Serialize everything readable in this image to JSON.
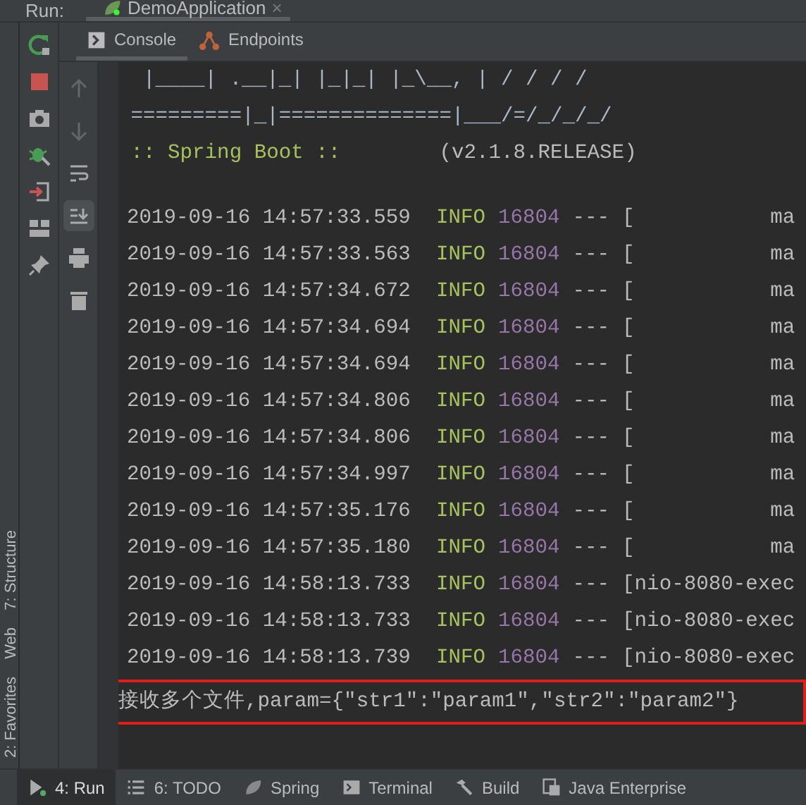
{
  "run_bar": {
    "label": "Run:",
    "tab": {
      "title": "DemoApplication",
      "close": "×"
    }
  },
  "console_tabs": [
    {
      "label": "Console",
      "kind": "console",
      "selected": true
    },
    {
      "label": "Endpoints",
      "kind": "endpoints",
      "selected": false
    }
  ],
  "banner": [
    {
      "text": "  |____| .__|_| |_|_| |_\\__, | / / / /",
      "kind": "art"
    },
    {
      "text": " =========|_|==============|___/=/_/_/_/",
      "kind": "art"
    },
    {
      "text": " :: Spring Boot ::        (v2.1.8.RELEASE)",
      "kind": "version"
    }
  ],
  "log": [
    {
      "timestamp": "2019-09-16 14:57:33.559",
      "level": "INFO",
      "pid": "16804",
      "separator": "---",
      "thread": "[           ma"
    },
    {
      "timestamp": "2019-09-16 14:57:33.563",
      "level": "INFO",
      "pid": "16804",
      "separator": "---",
      "thread": "[           ma"
    },
    {
      "timestamp": "2019-09-16 14:57:34.672",
      "level": "INFO",
      "pid": "16804",
      "separator": "---",
      "thread": "[           ma"
    },
    {
      "timestamp": "2019-09-16 14:57:34.694",
      "level": "INFO",
      "pid": "16804",
      "separator": "---",
      "thread": "[           ma"
    },
    {
      "timestamp": "2019-09-16 14:57:34.694",
      "level": "INFO",
      "pid": "16804",
      "separator": "---",
      "thread": "[           ma"
    },
    {
      "timestamp": "2019-09-16 14:57:34.806",
      "level": "INFO",
      "pid": "16804",
      "separator": "---",
      "thread": "[           ma"
    },
    {
      "timestamp": "2019-09-16 14:57:34.806",
      "level": "INFO",
      "pid": "16804",
      "separator": "---",
      "thread": "[           ma"
    },
    {
      "timestamp": "2019-09-16 14:57:34.997",
      "level": "INFO",
      "pid": "16804",
      "separator": "---",
      "thread": "[           ma"
    },
    {
      "timestamp": "2019-09-16 14:57:35.176",
      "level": "INFO",
      "pid": "16804",
      "separator": "---",
      "thread": "[           ma"
    },
    {
      "timestamp": "2019-09-16 14:57:35.180",
      "level": "INFO",
      "pid": "16804",
      "separator": "---",
      "thread": "[           ma"
    },
    {
      "timestamp": "2019-09-16 14:58:13.733",
      "level": "INFO",
      "pid": "16804",
      "separator": "---",
      "thread": "[nio-8080-exec"
    },
    {
      "timestamp": "2019-09-16 14:58:13.733",
      "level": "INFO",
      "pid": "16804",
      "separator": "---",
      "thread": "[nio-8080-exec"
    },
    {
      "timestamp": "2019-09-16 14:58:13.739",
      "level": "INFO",
      "pid": "16804",
      "separator": "---",
      "thread": "[nio-8080-exec"
    }
  ],
  "highlighted_output": "接收多个文件,param={\"str1\":\"param1\",\"str2\":\"param2\"}",
  "side_tabs": [
    "7: Structure",
    "Web",
    "2: Favorites"
  ],
  "bottom_tabs": [
    {
      "label": "4: Run",
      "kind": "run",
      "selected": true
    },
    {
      "label": "6: TODO",
      "kind": "todo",
      "selected": false
    },
    {
      "label": "Spring",
      "kind": "spring",
      "selected": false
    },
    {
      "label": "Terminal",
      "kind": "terminal",
      "selected": false
    },
    {
      "label": "Build",
      "kind": "build",
      "selected": false
    },
    {
      "label": "Java Enterprise",
      "kind": "enterprise",
      "selected": false
    }
  ]
}
